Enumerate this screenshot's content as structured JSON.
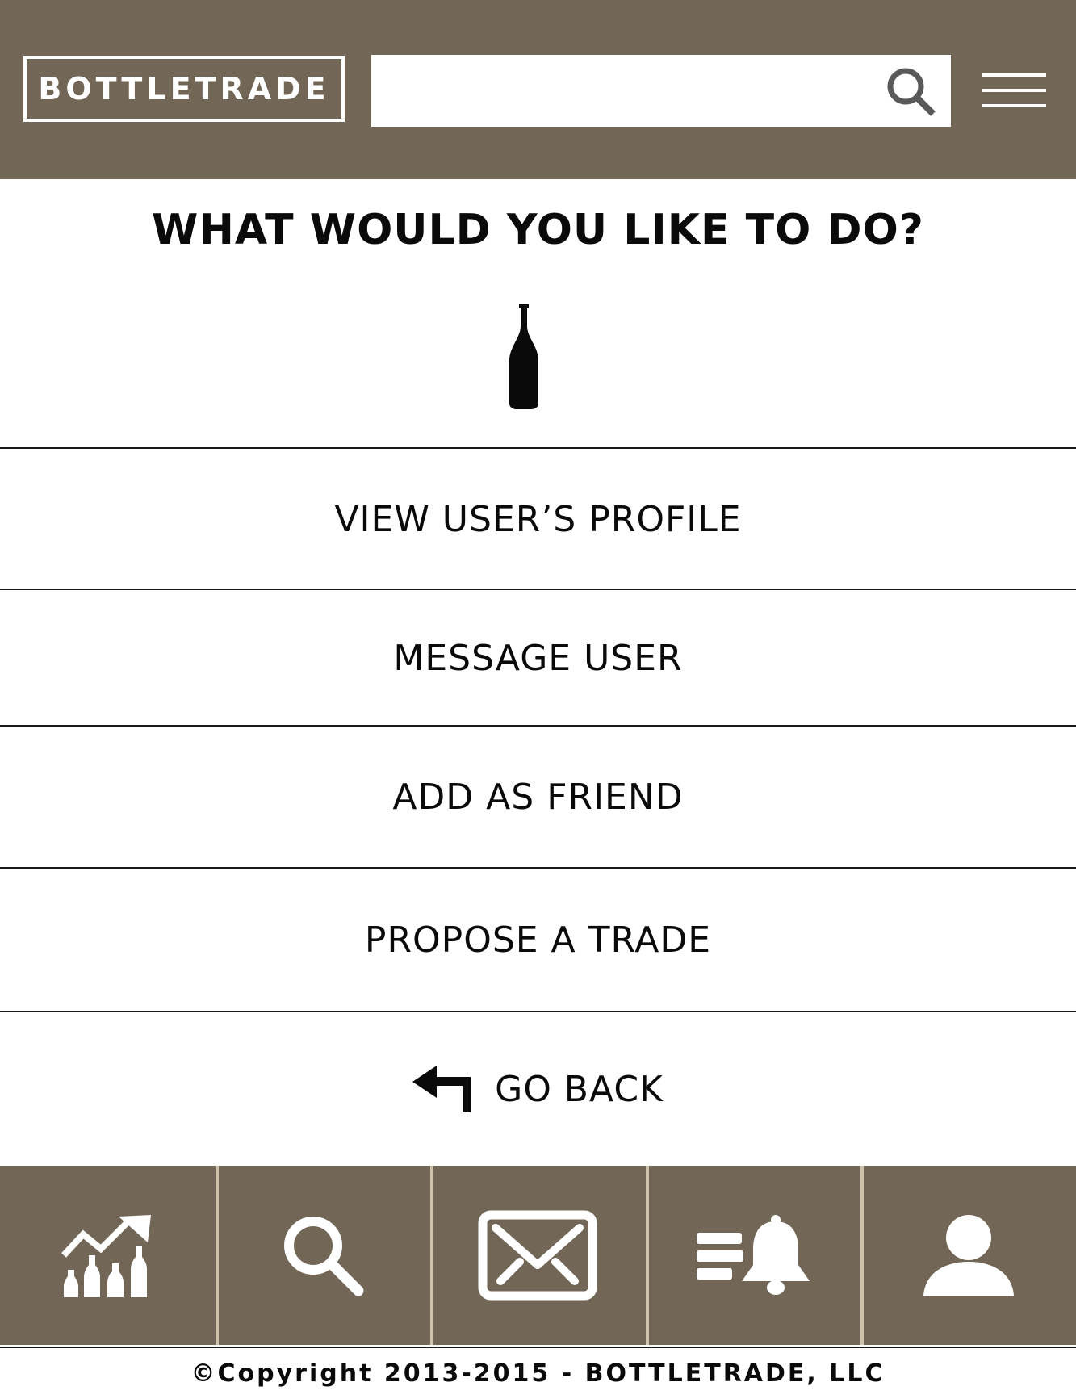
{
  "header": {
    "logo_text": "BOTTLETRADE",
    "search": {
      "value": "",
      "placeholder": ""
    },
    "search_icon": "search-icon",
    "menu_icon": "hamburger-menu-icon"
  },
  "main": {
    "title": "WHAT WOULD YOU LIKE TO DO?",
    "hero_icon": "bottle-icon",
    "options": [
      {
        "label": "VIEW USER’S PROFILE"
      },
      {
        "label": "MESSAGE USER"
      },
      {
        "label": "ADD AS FRIEND"
      },
      {
        "label": "PROPOSE A TRADE"
      },
      {
        "label": "GO BACK",
        "icon": "back-arrow-icon"
      }
    ]
  },
  "tabbar": {
    "tabs": [
      {
        "icon": "market-trends-icon"
      },
      {
        "icon": "search-icon"
      },
      {
        "icon": "mail-icon"
      },
      {
        "icon": "notifications-bell-icon"
      },
      {
        "icon": "profile-icon"
      }
    ]
  },
  "footer": {
    "copyright": "©Copyright 2013-2015 - BOTTLETRADE, LLC"
  },
  "colors": {
    "brand_brown": "#726657",
    "tab_divider": "#cfc2ab",
    "text": "#0a0a0a",
    "background": "#ffffff"
  }
}
